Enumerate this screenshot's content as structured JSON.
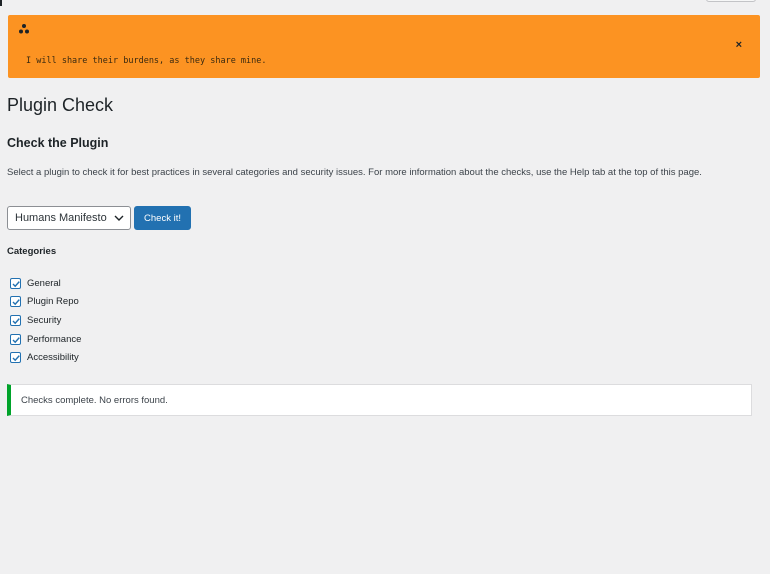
{
  "hum_notice": {
    "quote": "I will share their burdens, as they share mine.",
    "close_label": "×",
    "color": "#fc9322"
  },
  "page": {
    "title": "Plugin Check",
    "section_title": "Check the Plugin",
    "description": "Select a plugin to check it for best practices in several categories and security issues. For more information about the checks, use the Help tab at the top of this page."
  },
  "form": {
    "selected_plugin": "Humans Manifesto",
    "submit_label": "Check it!",
    "categories_title": "Categories",
    "categories": [
      {
        "label": "General",
        "checked": true
      },
      {
        "label": "Plugin Repo",
        "checked": true
      },
      {
        "label": "Security",
        "checked": true
      },
      {
        "label": "Performance",
        "checked": true
      },
      {
        "label": "Accessibility",
        "checked": true
      }
    ]
  },
  "result": {
    "message": "Checks complete. No errors found.",
    "status_color": "#00a32a"
  },
  "colors": {
    "accent": "#2271b1",
    "background": "#f0f0f1"
  },
  "icons": {
    "notice_icon": "triangle-dots-icon",
    "select_chevron": "chevron-down-icon",
    "checkbox": "checkmark-icon"
  }
}
